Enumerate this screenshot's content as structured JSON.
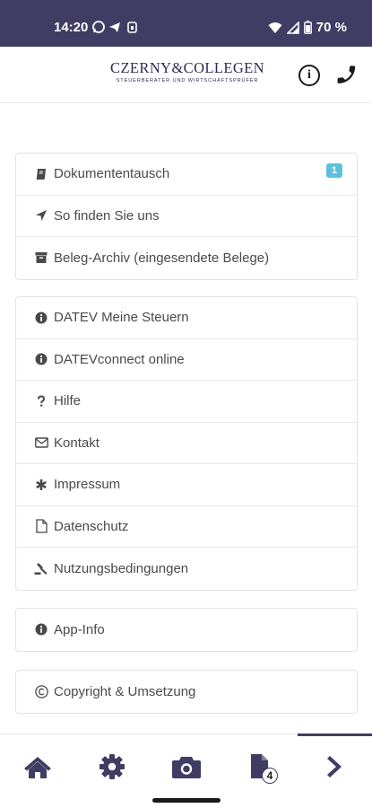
{
  "status_bar": {
    "time": "14:20",
    "notification_icons": [
      "whatsapp-icon",
      "telegram-icon",
      "sim-icon"
    ],
    "battery": "70 %"
  },
  "header": {
    "logo_name": "CZERNY&COLLEGEN",
    "logo_subtitle": "STEUERBERATER UND WIRTSCHAFTSPRÜFER",
    "info_icon_glyph": "i"
  },
  "groups": [
    {
      "items": [
        {
          "label": "Dokumententausch",
          "icon": "book-icon",
          "badge": "1"
        },
        {
          "label": "So finden Sie uns",
          "icon": "location-arrow-icon"
        },
        {
          "label": "Beleg-Archiv (eingesendete Belege)",
          "icon": "archive-icon"
        }
      ]
    },
    {
      "items": [
        {
          "label": "DATEV Meine Steuern",
          "icon": "info-circle-icon"
        },
        {
          "label": "DATEVconnect online",
          "icon": "info-circle-icon"
        },
        {
          "label": "Hilfe",
          "icon": "question-icon"
        },
        {
          "label": "Kontakt",
          "icon": "envelope-icon"
        },
        {
          "label": "Impressum",
          "icon": "asterisk-icon"
        },
        {
          "label": "Datenschutz",
          "icon": "file-icon"
        },
        {
          "label": "Nutzungsbedingungen",
          "icon": "gavel-icon"
        }
      ]
    },
    {
      "items": [
        {
          "label": "App-Info",
          "icon": "info-circle-icon"
        }
      ]
    },
    {
      "items": [
        {
          "label": "Copyright & Umsetzung",
          "icon": "copyright-icon"
        }
      ]
    }
  ],
  "bottom_nav": {
    "items": [
      "home-icon",
      "settings-icon",
      "camera-icon",
      "documents-icon",
      "forward-icon"
    ],
    "documents_badge": "4",
    "active": "forward-icon"
  },
  "colors": {
    "primary": "#3f3d63",
    "badge": "#5bc0de",
    "text": "#4a4a4a"
  }
}
